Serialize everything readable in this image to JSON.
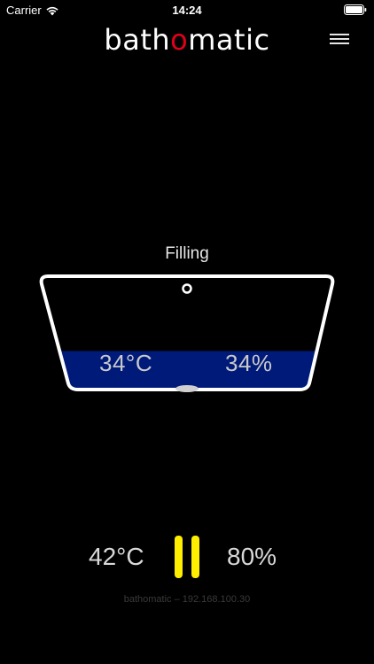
{
  "status_bar": {
    "carrier": "Carrier",
    "time": "14:24",
    "wifi_icon": "wifi-icon",
    "battery_icon": "battery-icon"
  },
  "header": {
    "logo_prefix": "bath",
    "logo_accent": "o",
    "logo_suffix": "matic",
    "accent_color": "#e0001b",
    "menu_icon": "hamburger-menu-icon"
  },
  "bath": {
    "state": "Filling",
    "current_temperature": "34°C",
    "current_level": "34%",
    "level_fraction": 0.34,
    "water_color": "#001a7a"
  },
  "controls": {
    "target_temperature": "42°C",
    "target_level": "80%",
    "pause_icon": "pause-icon",
    "pause_color": "#ffee00"
  },
  "footer": {
    "device_info": "bathomatic – 192.168.100.30"
  }
}
